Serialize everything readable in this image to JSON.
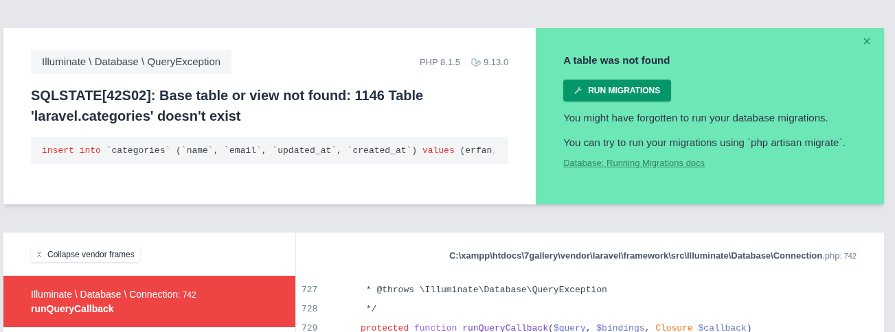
{
  "exception": {
    "class": "Illuminate \\ Database \\ QueryException",
    "php_version": "PHP 8.1.5",
    "laravel_version": "9.13.0",
    "message": "SQLSTATE[42S02]: Base table or view not found: 1146 Table 'laravel.categories' doesn't exist",
    "sql": [
      {
        "kind": "keyword",
        "text": "insert into"
      },
      {
        "kind": "plain",
        "text": " `categories` (`name`, `email`, `updated_at`, `created_at`) "
      },
      {
        "kind": "keyword",
        "text": "values"
      },
      {
        "kind": "plain",
        "text": " (erfan"
      },
      {
        "kind": "faded",
        "text": ","
      }
    ]
  },
  "solution": {
    "title": "A table was not found",
    "button": "RUN MIGRATIONS",
    "paragraphs": [
      "You might have forgotten to run your database migrations.",
      "You can try to run your migrations using `php artisan migrate`."
    ],
    "link": "Database: Running Migrations docs"
  },
  "frames": {
    "collapse_button": "Collapse vendor frames",
    "items": [
      {
        "class": "Illuminate \\ Database \\ Connection",
        "line": ": 742",
        "method": "runQueryCallback",
        "selected": true
      }
    ]
  },
  "code": {
    "path": "C:\\xampp\\htdocs\\7gallery\\vendor\\laravel\\framework\\src\\Illuminate\\Database\\Connection",
    "extension": ".php",
    "line": ": 742",
    "lines": [
      {
        "number": "727",
        "tokens": [
          {
            "kind": "comment",
            "text": " * @throws \\Illuminate\\Database\\QueryException"
          }
        ]
      },
      {
        "number": "728",
        "tokens": [
          {
            "kind": "comment",
            "text": " */"
          }
        ]
      },
      {
        "number": "729",
        "tokens": [
          {
            "kind": "keyword",
            "text": "protected "
          },
          {
            "kind": "storage",
            "text": "function "
          },
          {
            "kind": "function",
            "text": "runQueryCallback"
          },
          {
            "kind": "plain",
            "text": "("
          },
          {
            "kind": "variable",
            "text": "$query"
          },
          {
            "kind": "plain",
            "text": ", "
          },
          {
            "kind": "variable",
            "text": "$bindings"
          },
          {
            "kind": "plain",
            "text": ", "
          },
          {
            "kind": "type",
            "text": "Closure "
          },
          {
            "kind": "variable",
            "text": "$callback"
          },
          {
            "kind": "plain",
            "text": ")"
          }
        ]
      }
    ]
  }
}
